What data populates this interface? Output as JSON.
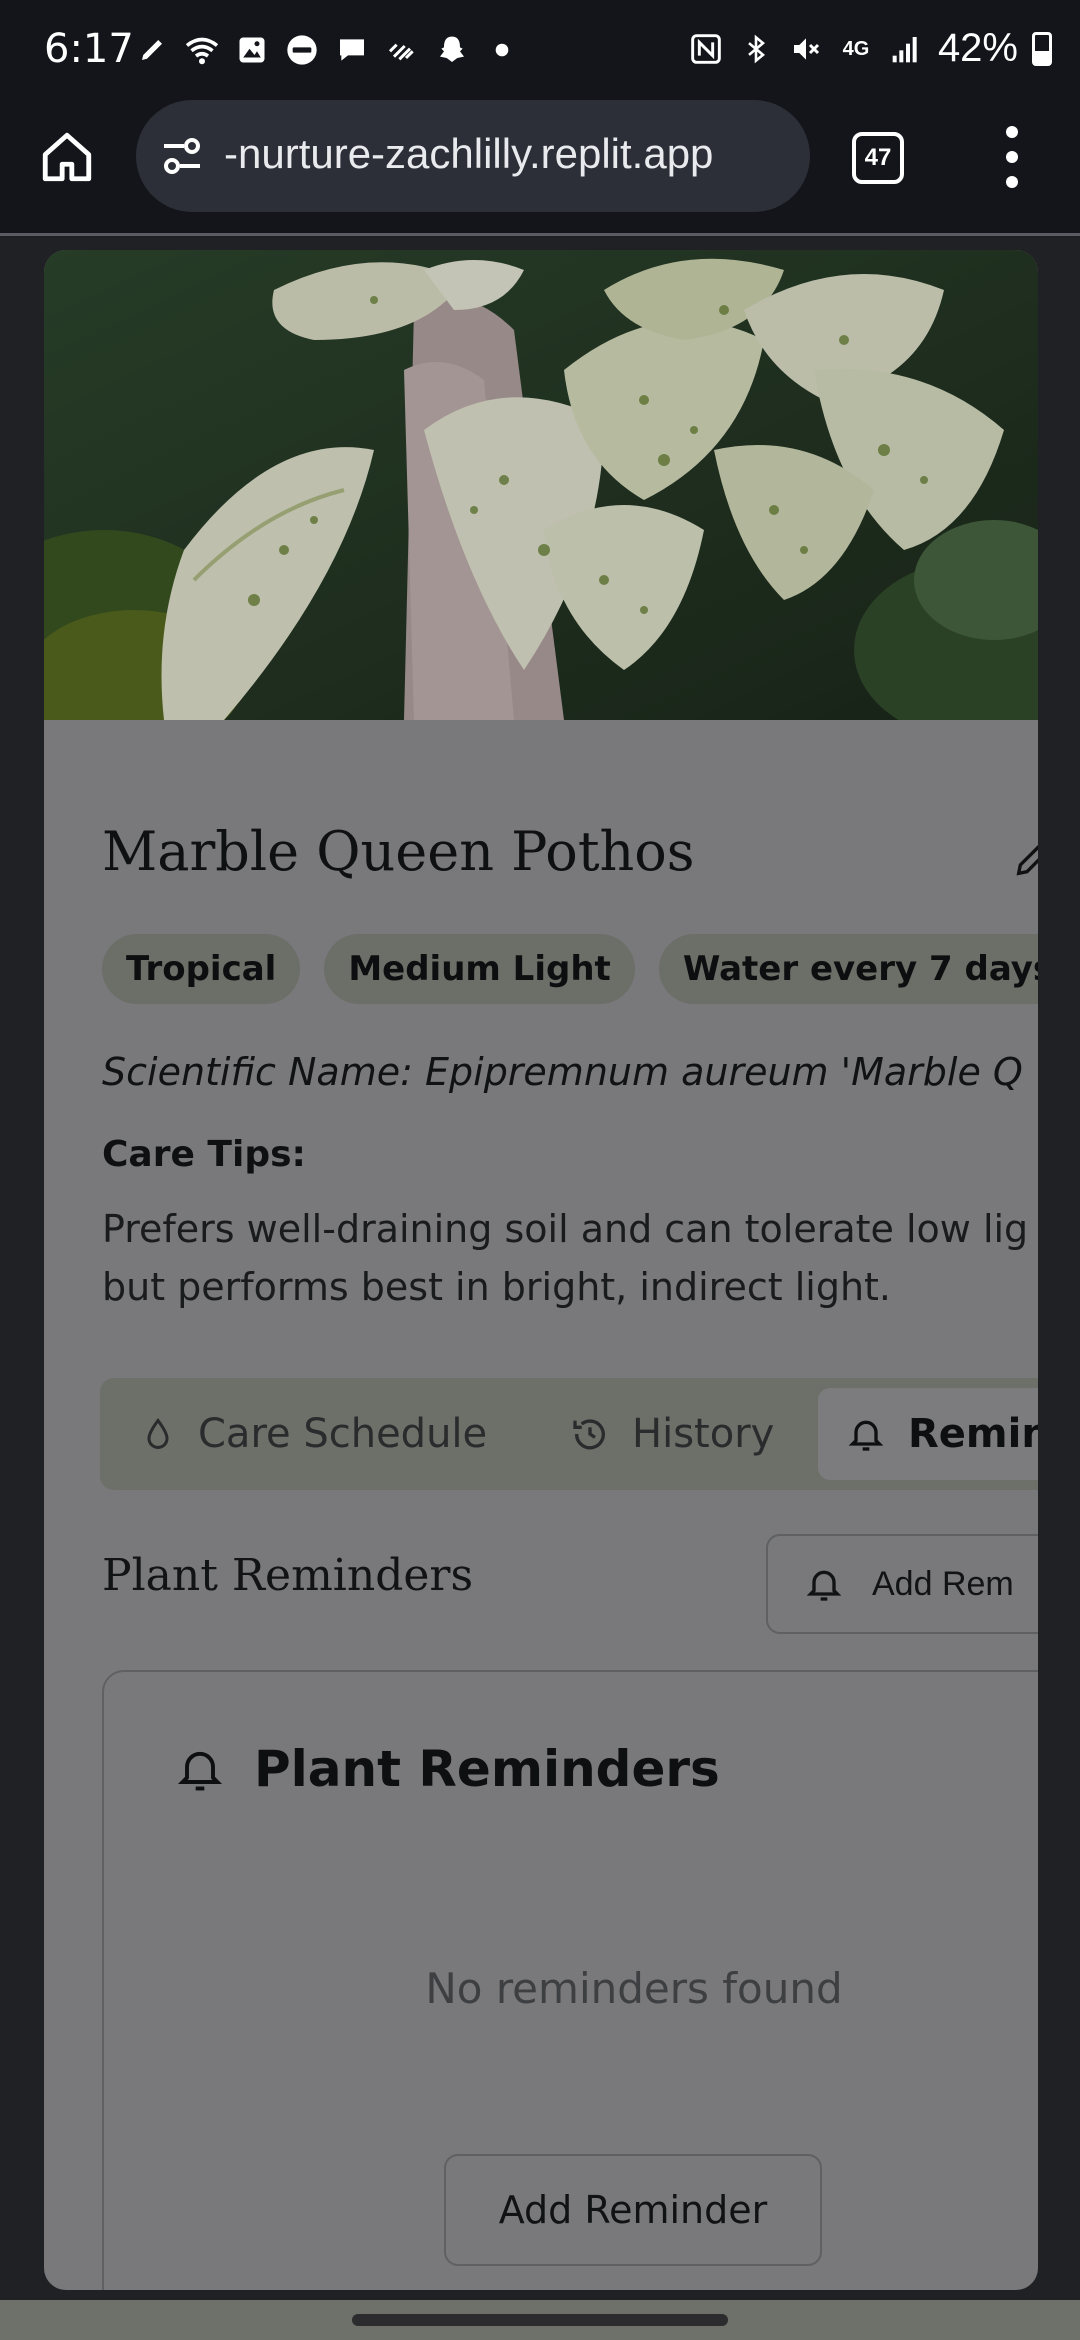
{
  "status_bar": {
    "time": "6:17",
    "left_icons": [
      "pen-icon",
      "wifi-call-icon",
      "gallery-icon",
      "wear-icon",
      "chat-icon",
      "data-saver-icon",
      "snapchat-icon",
      "dot-icon"
    ],
    "right_icons": [
      "nfc-icon",
      "bluetooth-icon",
      "mute-icon",
      "4g-lte-icon",
      "signal-icon"
    ],
    "network": "4G",
    "battery_percent": "42%"
  },
  "browser": {
    "url": "-nurture-zachlilly.replit.app",
    "tab_count": "47"
  },
  "plant": {
    "name": "Marble Queen Pothos",
    "tags": [
      "Tropical",
      "Medium Light",
      "Water every 7 days"
    ],
    "scientific_name": "Scientific Name: Epipremnum aureum 'Marble Q",
    "care_tips_label": "Care Tips:",
    "care_tips_line1": "Prefers well-draining soil and can tolerate low lig",
    "care_tips_line2": "but performs best in bright, indirect light."
  },
  "tabs": {
    "care": "Care Schedule",
    "history": "History",
    "reminders": "Remind"
  },
  "reminders_section": {
    "title": "Plant Reminders",
    "add_button_label": "Add Rem",
    "card_title": "Plant Reminders",
    "empty_text": "No reminders found",
    "add_reminder_label": "Add Reminder"
  }
}
